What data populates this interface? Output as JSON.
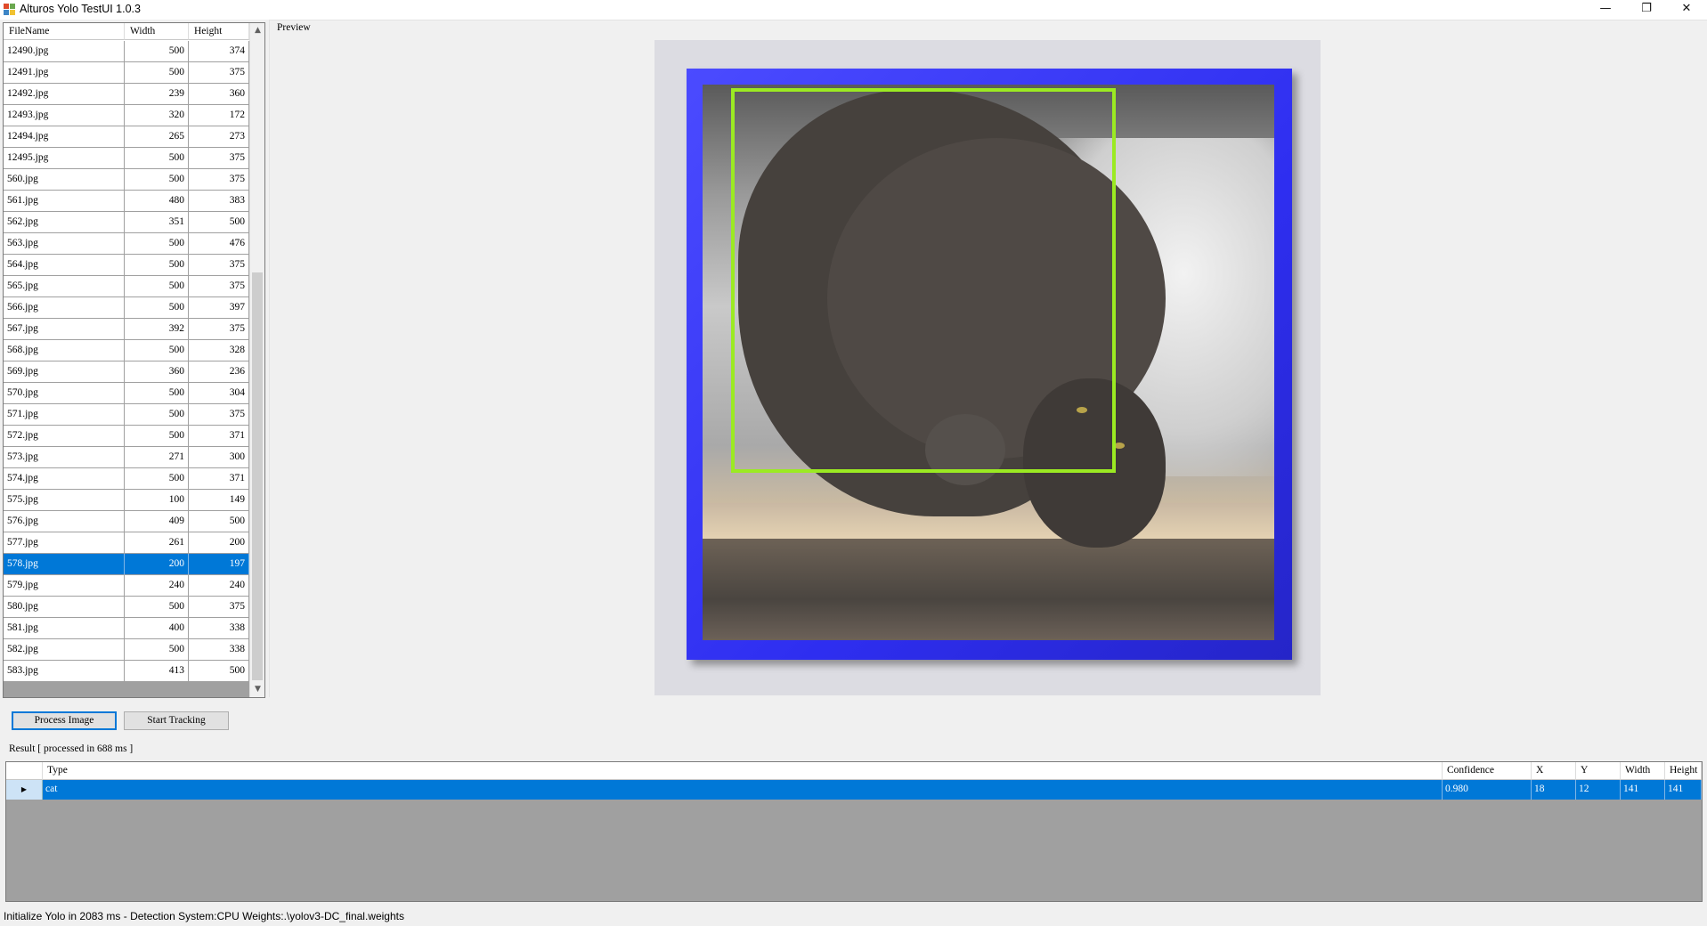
{
  "window": {
    "title": "Alturos Yolo TestUI 1.0.3",
    "minimize_glyph": "—",
    "restore_glyph": "❐",
    "close_glyph": "✕"
  },
  "file_list": {
    "columns": [
      "FileName",
      "Width",
      "Height"
    ],
    "rows": [
      {
        "name": "12490.jpg",
        "width": "500",
        "height": "374"
      },
      {
        "name": "12491.jpg",
        "width": "500",
        "height": "375"
      },
      {
        "name": "12492.jpg",
        "width": "239",
        "height": "360"
      },
      {
        "name": "12493.jpg",
        "width": "320",
        "height": "172"
      },
      {
        "name": "12494.jpg",
        "width": "265",
        "height": "273"
      },
      {
        "name": "12495.jpg",
        "width": "500",
        "height": "375"
      },
      {
        "name": "560.jpg",
        "width": "500",
        "height": "375"
      },
      {
        "name": "561.jpg",
        "width": "480",
        "height": "383"
      },
      {
        "name": "562.jpg",
        "width": "351",
        "height": "500"
      },
      {
        "name": "563.jpg",
        "width": "500",
        "height": "476"
      },
      {
        "name": "564.jpg",
        "width": "500",
        "height": "375"
      },
      {
        "name": "565.jpg",
        "width": "500",
        "height": "375"
      },
      {
        "name": "566.jpg",
        "width": "500",
        "height": "397"
      },
      {
        "name": "567.jpg",
        "width": "392",
        "height": "375"
      },
      {
        "name": "568.jpg",
        "width": "500",
        "height": "328"
      },
      {
        "name": "569.jpg",
        "width": "360",
        "height": "236"
      },
      {
        "name": "570.jpg",
        "width": "500",
        "height": "304"
      },
      {
        "name": "571.jpg",
        "width": "500",
        "height": "375"
      },
      {
        "name": "572.jpg",
        "width": "500",
        "height": "371"
      },
      {
        "name": "573.jpg",
        "width": "271",
        "height": "300"
      },
      {
        "name": "574.jpg",
        "width": "500",
        "height": "371"
      },
      {
        "name": "575.jpg",
        "width": "100",
        "height": "149"
      },
      {
        "name": "576.jpg",
        "width": "409",
        "height": "500"
      },
      {
        "name": "577.jpg",
        "width": "261",
        "height": "200"
      },
      {
        "name": "578.jpg",
        "width": "200",
        "height": "197",
        "selected": true
      },
      {
        "name": "579.jpg",
        "width": "240",
        "height": "240"
      },
      {
        "name": "580.jpg",
        "width": "500",
        "height": "375"
      },
      {
        "name": "581.jpg",
        "width": "400",
        "height": "338"
      },
      {
        "name": "582.jpg",
        "width": "500",
        "height": "338"
      },
      {
        "name": "583.jpg",
        "width": "413",
        "height": "500"
      }
    ],
    "scroll_up_glyph": "▲",
    "scroll_down_glyph": "▼"
  },
  "preview": {
    "label": "Preview"
  },
  "buttons": {
    "process_image": "Process Image",
    "start_tracking": "Start Tracking"
  },
  "result": {
    "label": "Result [ processed in 688 ms ]",
    "columns": [
      "Type",
      "Confidence",
      "X",
      "Y",
      "Width",
      "Height"
    ],
    "row_indicator": "▶",
    "rows": [
      {
        "type": "cat",
        "confidence": "0.980",
        "x": "18",
        "y": "12",
        "width": "141",
        "height": "141"
      }
    ]
  },
  "status_bar": {
    "text": "Initialize Yolo in 2083 ms - Detection System:CPU  Weights:.\\yolov3-DC_final.weights"
  },
  "colors": {
    "selection": "#0078d7",
    "bounding_box": "#9bea22",
    "frame_blue": "#3a3aff"
  }
}
